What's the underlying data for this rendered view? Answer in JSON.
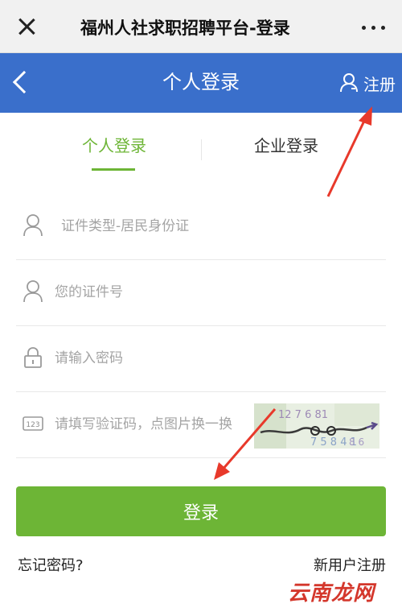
{
  "wechat_bar": {
    "title": "福州人社求职招聘平台-登录",
    "close_icon": "close-icon",
    "more_icon": "more-dots-icon"
  },
  "header": {
    "title": "个人登录",
    "back_icon": "chevron-left-icon",
    "register_label": "注册",
    "register_icon": "user-icon"
  },
  "tabs": [
    {
      "label": "个人登录",
      "active": true
    },
    {
      "label": "企业登录",
      "active": false
    }
  ],
  "form": {
    "id_type_placeholder": "证件类型-居民身份证",
    "id_number_placeholder": "您的证件号",
    "password_placeholder": "请输入密码",
    "captcha_placeholder": "请填写验证码，点图片换一换",
    "captcha_icon_text": "123"
  },
  "login_button": "登录",
  "forgot_password": "忘记密码?",
  "new_user_register": "新用户注册",
  "watermark": "云南龙网",
  "colors": {
    "header_blue": "#3a6fcb",
    "accent_green": "#6db536",
    "annotation_red": "#e8392b"
  }
}
